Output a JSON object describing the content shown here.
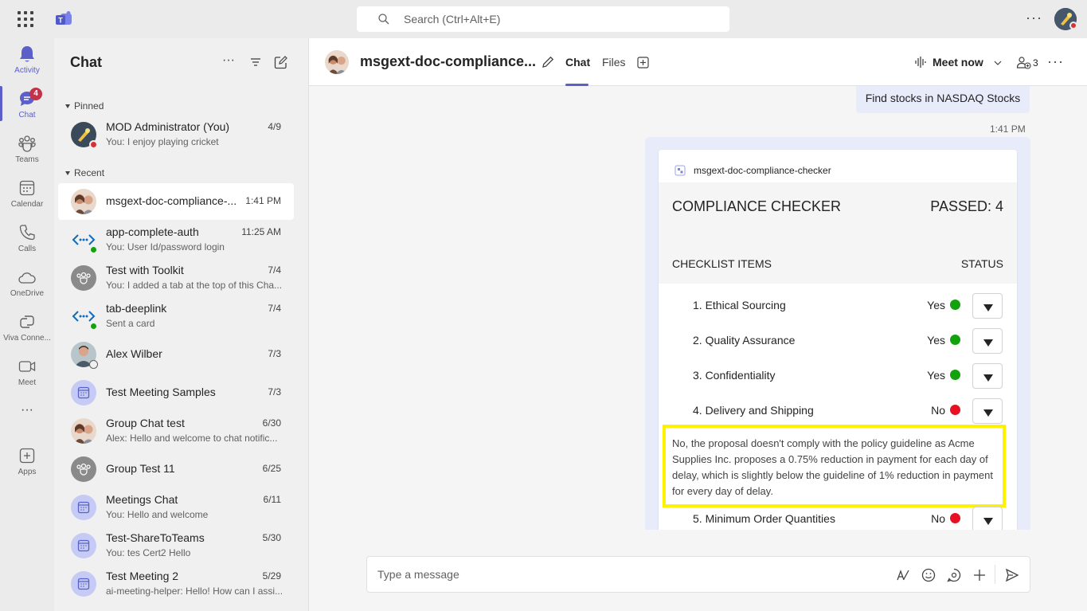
{
  "topbar": {
    "search_placeholder": "Search (Ctrl+Alt+E)",
    "more": "···"
  },
  "rail": {
    "items": [
      {
        "label": "Activity",
        "icon": "bell-icon"
      },
      {
        "label": "Chat",
        "icon": "chat-icon",
        "badge": "4"
      },
      {
        "label": "Teams",
        "icon": "teams-icon"
      },
      {
        "label": "Calendar",
        "icon": "calendar-icon"
      },
      {
        "label": "Calls",
        "icon": "phone-icon"
      },
      {
        "label": "OneDrive",
        "icon": "cloud-icon"
      },
      {
        "label": "Viva Conne...",
        "icon": "viva-icon"
      },
      {
        "label": "Meet",
        "icon": "video-icon"
      },
      {
        "label": "···",
        "icon": "more-icon"
      },
      {
        "label": "Apps",
        "icon": "apps-icon"
      }
    ]
  },
  "chatlist": {
    "title": "Chat",
    "pinned_label": "Pinned",
    "recent_label": "Recent",
    "pinned": [
      {
        "name": "MOD Administrator (You)",
        "preview": "You: I enjoy playing cricket",
        "time": "4/9"
      }
    ],
    "recent": [
      {
        "name": "msgext-doc-compliance-...",
        "preview": "",
        "time": "1:41 PM"
      },
      {
        "name": "app-complete-auth",
        "preview": "You: User Id/password login",
        "time": "11:25 AM"
      },
      {
        "name": "Test with Toolkit",
        "preview": "You: I added a tab at the top of this Cha...",
        "time": "7/4"
      },
      {
        "name": "tab-deeplink",
        "preview": "Sent a card",
        "time": "7/4"
      },
      {
        "name": "Alex Wilber",
        "preview": "",
        "time": "7/3"
      },
      {
        "name": "Test Meeting Samples",
        "preview": "",
        "time": "7/3"
      },
      {
        "name": "Group Chat test",
        "preview": "Alex: Hello and welcome to chat notific...",
        "time": "6/30"
      },
      {
        "name": "Group Test 11",
        "preview": "",
        "time": "6/25"
      },
      {
        "name": "Meetings Chat",
        "preview": "You: Hello and welcome",
        "time": "6/11"
      },
      {
        "name": "Test-ShareToTeams",
        "preview": "You: tes Cert2 Hello",
        "time": "5/30"
      },
      {
        "name": "Test Meeting 2",
        "preview": "ai-meeting-helper: Hello! How can I assi...",
        "time": "5/29"
      }
    ]
  },
  "header": {
    "title": "msgext-doc-compliance...",
    "tabs": [
      "Chat",
      "Files"
    ],
    "meet_now": "Meet now",
    "participants": "3",
    "more": "···"
  },
  "messages": {
    "my_message": "Find stocks in NASDAQ Stocks",
    "time": "1:41 PM"
  },
  "card": {
    "app_name": "msgext-doc-compliance-checker",
    "title": "COMPLIANCE CHECKER",
    "passed": "PASSED: 4",
    "checklist_label": "CHECKLIST ITEMS",
    "status_label": "STATUS",
    "items": [
      {
        "label": "1. Ethical Sourcing",
        "value": "Yes",
        "color": "#13a10e"
      },
      {
        "label": "2. Quality Assurance",
        "value": "Yes",
        "color": "#13a10e"
      },
      {
        "label": "3. Confidentiality",
        "value": "Yes",
        "color": "#13a10e"
      },
      {
        "label": "4. Delivery and Shipping",
        "value": "No",
        "color": "#e81123"
      },
      {
        "label": "5. Minimum Order Quantities",
        "value": "No",
        "color": "#e81123"
      }
    ],
    "explanation": "No, the proposal doesn't comply with the policy guideline as Acme Supplies Inc. proposes a 0.75% reduction in payment for each day of delay, which is slightly below the guideline of 1% reduction in payment for every day of delay."
  },
  "composer": {
    "placeholder": "Type a message"
  },
  "colors": {
    "accent": "#5b5fc7",
    "highlight": "#fff200",
    "yes": "#13a10e",
    "no": "#e81123"
  }
}
